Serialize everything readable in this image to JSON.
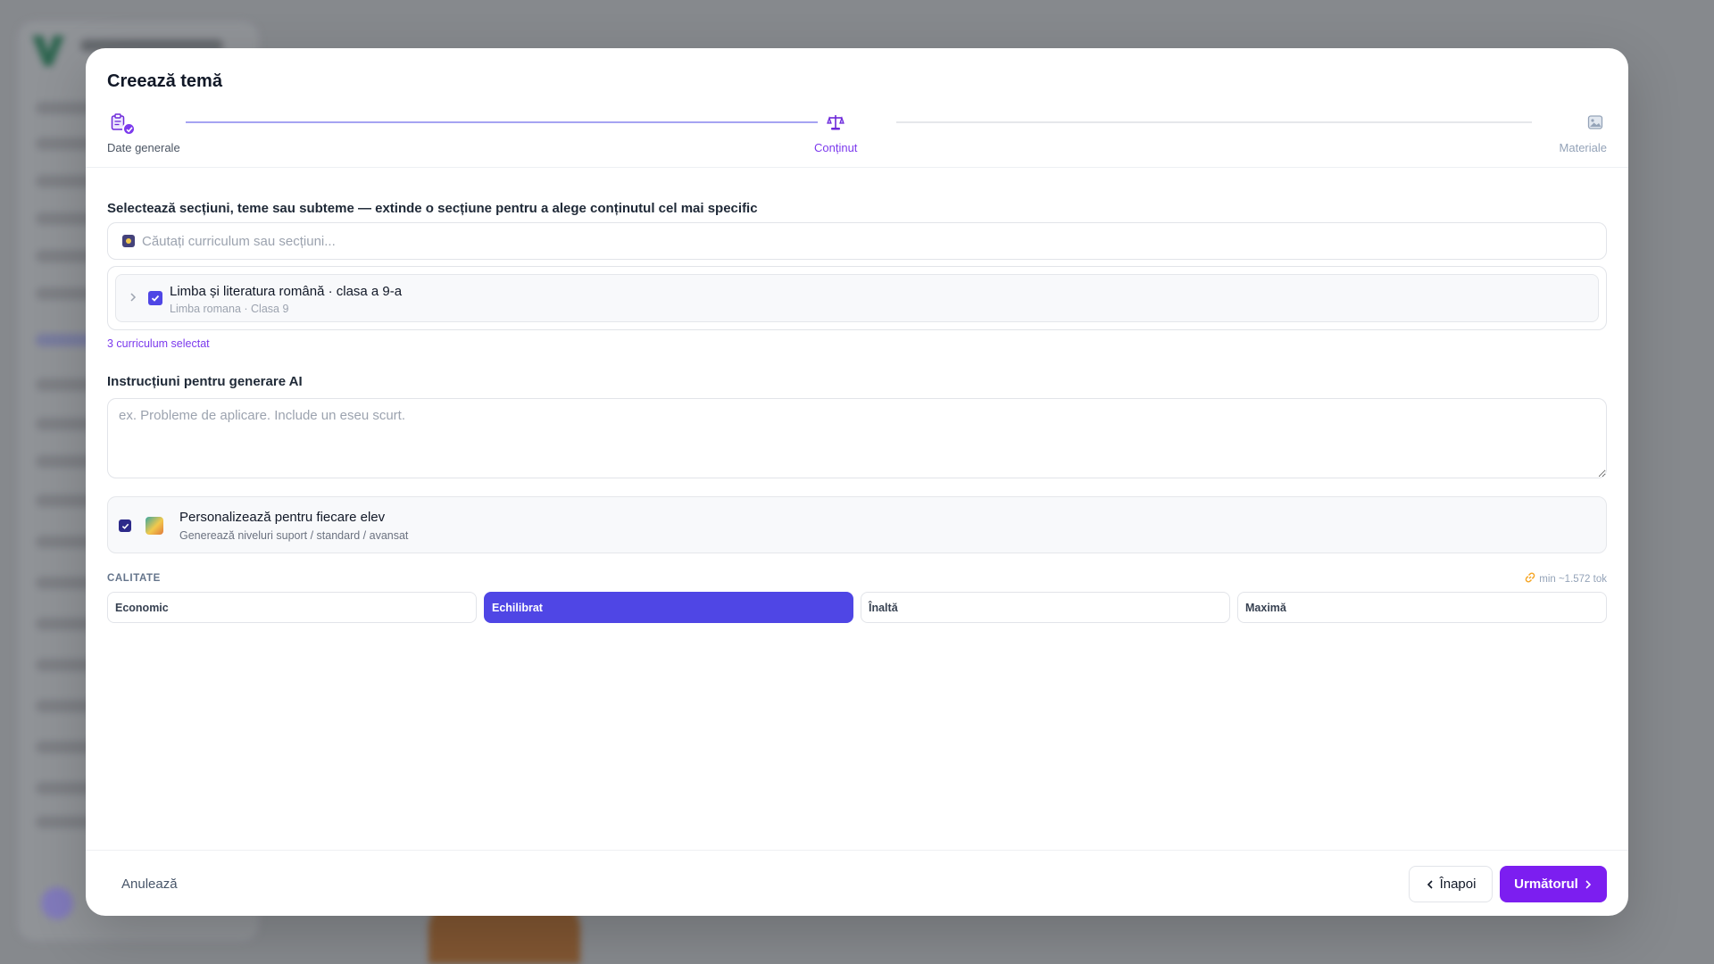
{
  "modal": {
    "title": "Creează temă"
  },
  "stepper": {
    "steps": [
      {
        "label": "Date generale",
        "state": "done",
        "icon": "clipboard-icon"
      },
      {
        "label": "Conținut",
        "state": "active",
        "icon": "balance-scale-icon"
      },
      {
        "label": "Materiale",
        "state": "pending",
        "icon": "image-icon"
      }
    ]
  },
  "curriculum": {
    "section_label": "Selectează secțiuni, teme sau subteme — extinde o secțiune pentru a alege conținutul cel mai specific",
    "search_placeholder": "Căutați curriculum sau secțiuni...",
    "items": [
      {
        "name": "Limba și literatura română · clasa a 9-a",
        "sub": "Limba romana · Clasa 9",
        "checked": true,
        "expanded": false
      }
    ],
    "selected_count": "3 curriculum selectat"
  },
  "instructions": {
    "label": "Instrucțiuni pentru generare AI",
    "placeholder": "ex. Probleme de aplicare. Include un eseu scurt.",
    "value": ""
  },
  "personalize": {
    "checked": true,
    "title": "Personalizează pentru fiecare elev",
    "subtitle": "Generează niveluri suport / standard / avansat"
  },
  "quality": {
    "label": "CALITATE",
    "token_info": "min ~1.572 tok",
    "options": [
      "Economic",
      "Echilibrat",
      "Înaltă",
      "Maximă"
    ],
    "selected": "Echilibrat"
  },
  "footer": {
    "cancel": "Anulează",
    "back": "Înapoi",
    "next": "Următorul"
  },
  "colors": {
    "accent": "#7c3aed",
    "primary_button": "#7c1ef0",
    "selected_option": "#4f46e5"
  }
}
